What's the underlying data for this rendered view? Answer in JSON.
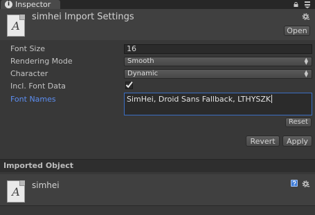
{
  "window": {
    "tab_label": "Inspector",
    "tab_icon": "info-icon",
    "lock_icon": "lock-icon",
    "menu_icon": "menu-icon"
  },
  "header": {
    "asset_letter": "A",
    "title": "simhei Import Settings",
    "open_label": "Open"
  },
  "properties": {
    "font_size": {
      "label": "Font Size",
      "value": "16"
    },
    "rendering_mode": {
      "label": "Rendering Mode",
      "value": "Smooth"
    },
    "character": {
      "label": "Character",
      "value": "Dynamic"
    },
    "incl_font_data": {
      "label": "Incl. Font Data",
      "checked": true,
      "checkmark": "✔"
    },
    "font_names": {
      "label": "Font Names",
      "value": "SimHei, Droid Sans Fallback, LTHYSZK"
    }
  },
  "buttons": {
    "reset": "Reset",
    "revert": "Revert",
    "apply": "Apply"
  },
  "imported": {
    "section_title": "Imported Object",
    "asset_letter": "A",
    "name": "simhei"
  },
  "colors": {
    "background": "#383838",
    "header": "#404040",
    "accent_label": "#5c8ef2",
    "focus_border": "#3b6ec4",
    "help_icon": "#3f7cd8"
  }
}
